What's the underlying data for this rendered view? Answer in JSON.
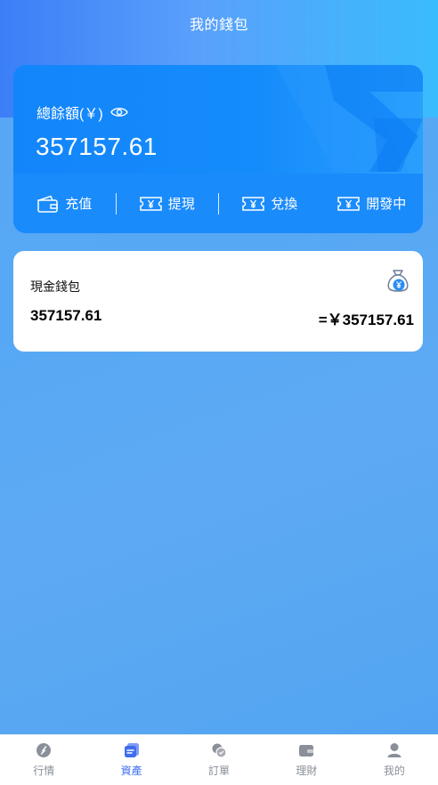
{
  "header": {
    "title": "我的錢包"
  },
  "balance": {
    "label": "總餘額(￥)",
    "amount": "357157.61"
  },
  "actions": [
    {
      "label": "充值",
      "icon": "wallet-icon"
    },
    {
      "label": "提現",
      "icon": "ticket-yen-icon"
    },
    {
      "label": "兌換",
      "icon": "ticket-yen-icon"
    },
    {
      "label": "開發中",
      "icon": "ticket-yen-icon"
    }
  ],
  "wallet": {
    "name": "現金錢包",
    "amount": "357157.61",
    "equivalent": "=￥357157.61",
    "icon": "money-bag-icon"
  },
  "tabbar": {
    "items": [
      {
        "label": "行情",
        "icon": "market-icon",
        "active": false
      },
      {
        "label": "資產",
        "icon": "asset-icon",
        "active": true
      },
      {
        "label": "訂單",
        "icon": "order-icon",
        "active": false
      },
      {
        "label": "理財",
        "icon": "finance-icon",
        "active": false
      },
      {
        "label": "我的",
        "icon": "user-icon",
        "active": false
      }
    ]
  },
  "colors": {
    "accent": "#1a8bfb",
    "tab_active": "#3f6df0",
    "tab_inactive": "#8a8f99"
  }
}
